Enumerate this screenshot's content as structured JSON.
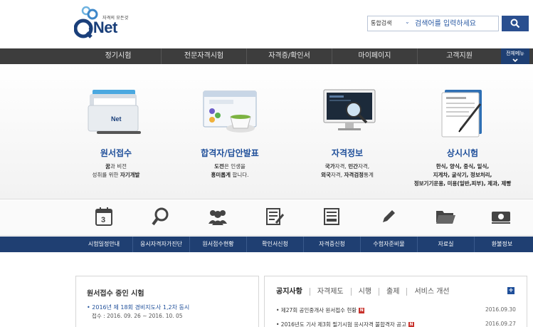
{
  "header": {
    "logo_tagline": "자격의 모든것",
    "logo_text": "-Net",
    "search_scope": "통합검색",
    "search_placeholder": "검색어를 입력하세요"
  },
  "topnav": {
    "items": [
      "정기시험",
      "전문자격시험",
      "자격증/확인서",
      "마이페이지",
      "고객지원"
    ],
    "all_menu": "전체메뉴"
  },
  "features": [
    {
      "title": "원서접수",
      "desc_line1_a": "꿈",
      "desc_line1_b": "과 비전",
      "desc_line2_a": "성취를 위한 ",
      "desc_line2_b": "자기개발"
    },
    {
      "title": "합격자/답안발표",
      "desc_line1_a": "도전",
      "desc_line1_b": "은 인생을",
      "desc_line2_a": "흥미롭게",
      "desc_line2_b": " 합니다."
    },
    {
      "title": "자격정보",
      "desc_line1_a": "국가",
      "desc_line1_b": "자격, ",
      "desc_line1_c": "민간",
      "desc_line1_d": "자격,",
      "desc_line2_a": "외국",
      "desc_line2_b": "자격, ",
      "desc_line2_c": "자격검정",
      "desc_line2_d": "통계"
    },
    {
      "title": "상시시험",
      "desc_line1": "한식, 양식, 중식, 일식,",
      "desc_line2": "지게차, 굴삭기, 정보처리,",
      "desc_line3": "정보기기운용, 미용(일반,피부), 제과, 제빵"
    }
  ],
  "quick_icons": [
    "calendar-icon",
    "search-icon",
    "users-icon",
    "document-icon",
    "certificate-icon",
    "pencil-icon",
    "folder-icon",
    "money-icon"
  ],
  "calendar_day": "3",
  "bluemenu": [
    "시험일정안내",
    "응시자격자가진단",
    "원서접수현황",
    "확인서신청",
    "자격증신청",
    "수험자준비물",
    "자료실",
    "환불정보"
  ],
  "exam_panel": {
    "title": "원서접수 중인 시험",
    "item": "• 2016년 제 18회 경비지도사 1,2차 동시",
    "period": "접수 : 2016. 09. 26 ~ 2016. 10. 05"
  },
  "notice_panel": {
    "tabs": [
      "공지사항",
      "자격제도",
      "시행",
      "출제",
      "서비스 개선"
    ],
    "plus": "+",
    "notices": [
      {
        "text": "• 제27회 공인중개사 원서접수 현황",
        "badge": "N",
        "date": "2016.09.30"
      },
      {
        "text": "• 2016년도 기사 제3회 필기시험 응시자격 불합격자 공고",
        "badge": "N",
        "date": "2016.09.27"
      }
    ]
  },
  "colors": {
    "brand_blue": "#1f4f9a",
    "nav_dark": "#3d3d3d",
    "menu_navy": "#1f3f72",
    "badge_red": "#c8322c"
  }
}
